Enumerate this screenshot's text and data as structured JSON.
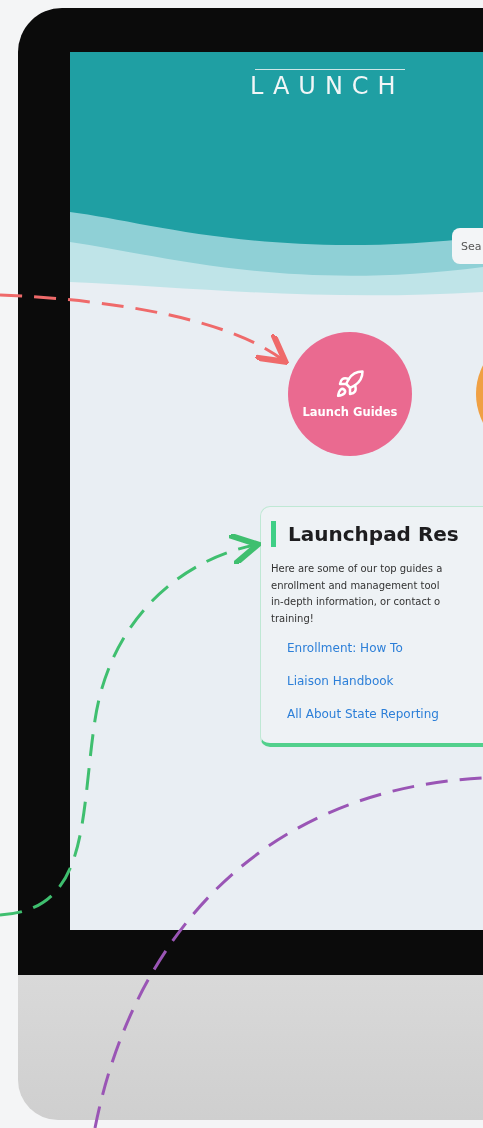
{
  "header": {
    "logo": "LAUNCH",
    "search": {
      "placeholder": "Sea"
    }
  },
  "tiles": [
    {
      "label": "Launch Guides",
      "color": "#ea6a90"
    },
    {
      "color": "#f0a043"
    }
  ],
  "card": {
    "title": "Launchpad Res",
    "paragraph_lines": [
      "Here are some of our top guides a",
      "enrollment and management tool",
      "in-depth information, or contact o",
      "training!"
    ],
    "links": [
      "Enrollment: How To",
      "Liaison Handbook",
      "All About State Reporting"
    ]
  }
}
